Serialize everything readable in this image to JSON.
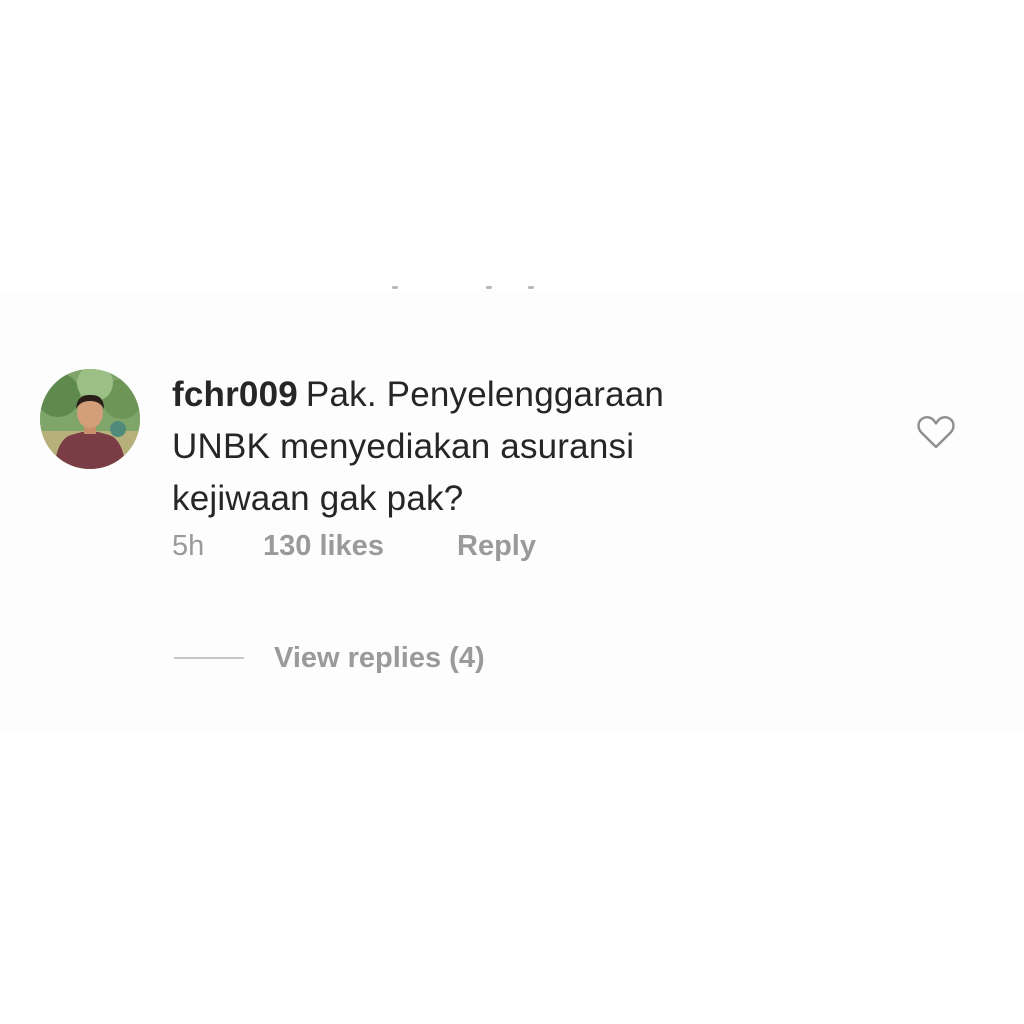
{
  "comment": {
    "username": "fchr009",
    "text": "Pak. Penyelenggaraan\nUNBK menyediakan asuransi\nkejiwaan gak pak?",
    "time": "5h",
    "likes": "130 likes",
    "reply_label": "Reply",
    "view_replies_label": "View replies (4)"
  },
  "icons": {
    "like": "heart-outline-icon"
  },
  "colors": {
    "text": "#262626",
    "muted": "#9a9a9a",
    "divider": "#c7c7c7",
    "card_background": "#fdfdfd"
  }
}
